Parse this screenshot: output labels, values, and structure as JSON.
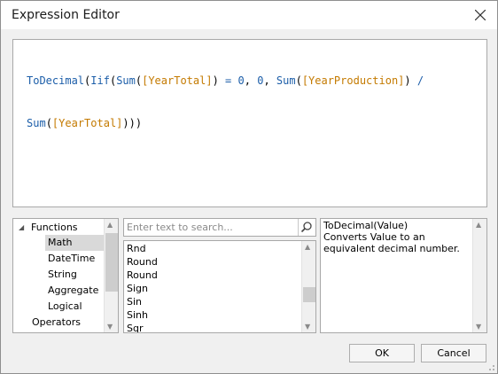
{
  "window": {
    "title": "Expression Editor"
  },
  "editor": {
    "line1": [
      {
        "t": "ToDecimal",
        "c": "fn"
      },
      {
        "t": "(",
        "c": ""
      },
      {
        "t": "Iif",
        "c": "fn"
      },
      {
        "t": "(",
        "c": ""
      },
      {
        "t": "Sum",
        "c": "fn"
      },
      {
        "t": "(",
        "c": ""
      },
      {
        "t": "[YearTotal]",
        "c": "fld"
      },
      {
        "t": ") ",
        "c": ""
      },
      {
        "t": "=",
        "c": "op"
      },
      {
        "t": " ",
        "c": ""
      },
      {
        "t": "0",
        "c": "num"
      },
      {
        "t": ", ",
        "c": ""
      },
      {
        "t": "0",
        "c": "num"
      },
      {
        "t": ", ",
        "c": ""
      },
      {
        "t": "Sum",
        "c": "fn"
      },
      {
        "t": "(",
        "c": ""
      },
      {
        "t": "[YearProduction]",
        "c": "fld"
      },
      {
        "t": ") ",
        "c": ""
      },
      {
        "t": "/",
        "c": "op"
      }
    ],
    "line2": [
      {
        "t": "Sum",
        "c": "fn"
      },
      {
        "t": "(",
        "c": ""
      },
      {
        "t": "[YearTotal]",
        "c": "fld"
      },
      {
        "t": ")))",
        "c": ""
      }
    ]
  },
  "tree": {
    "root": "Functions",
    "children": [
      "Math",
      "DateTime",
      "String",
      "Aggregate",
      "Logical"
    ],
    "selected": "Math",
    "next": "Operators"
  },
  "search": {
    "placeholder": "Enter text to search..."
  },
  "functions_list": [
    "Rnd",
    "Round",
    "Round",
    "Sign",
    "Sin",
    "Sinh",
    "Sqr"
  ],
  "description": {
    "signature": "ToDecimal(Value)",
    "text": "Converts Value to an equivalent decimal number."
  },
  "buttons": {
    "ok": "OK",
    "cancel": "Cancel"
  },
  "colors": {
    "function": "#1c5ea9",
    "field": "#c47a00",
    "selection": "#d9d9d9"
  }
}
